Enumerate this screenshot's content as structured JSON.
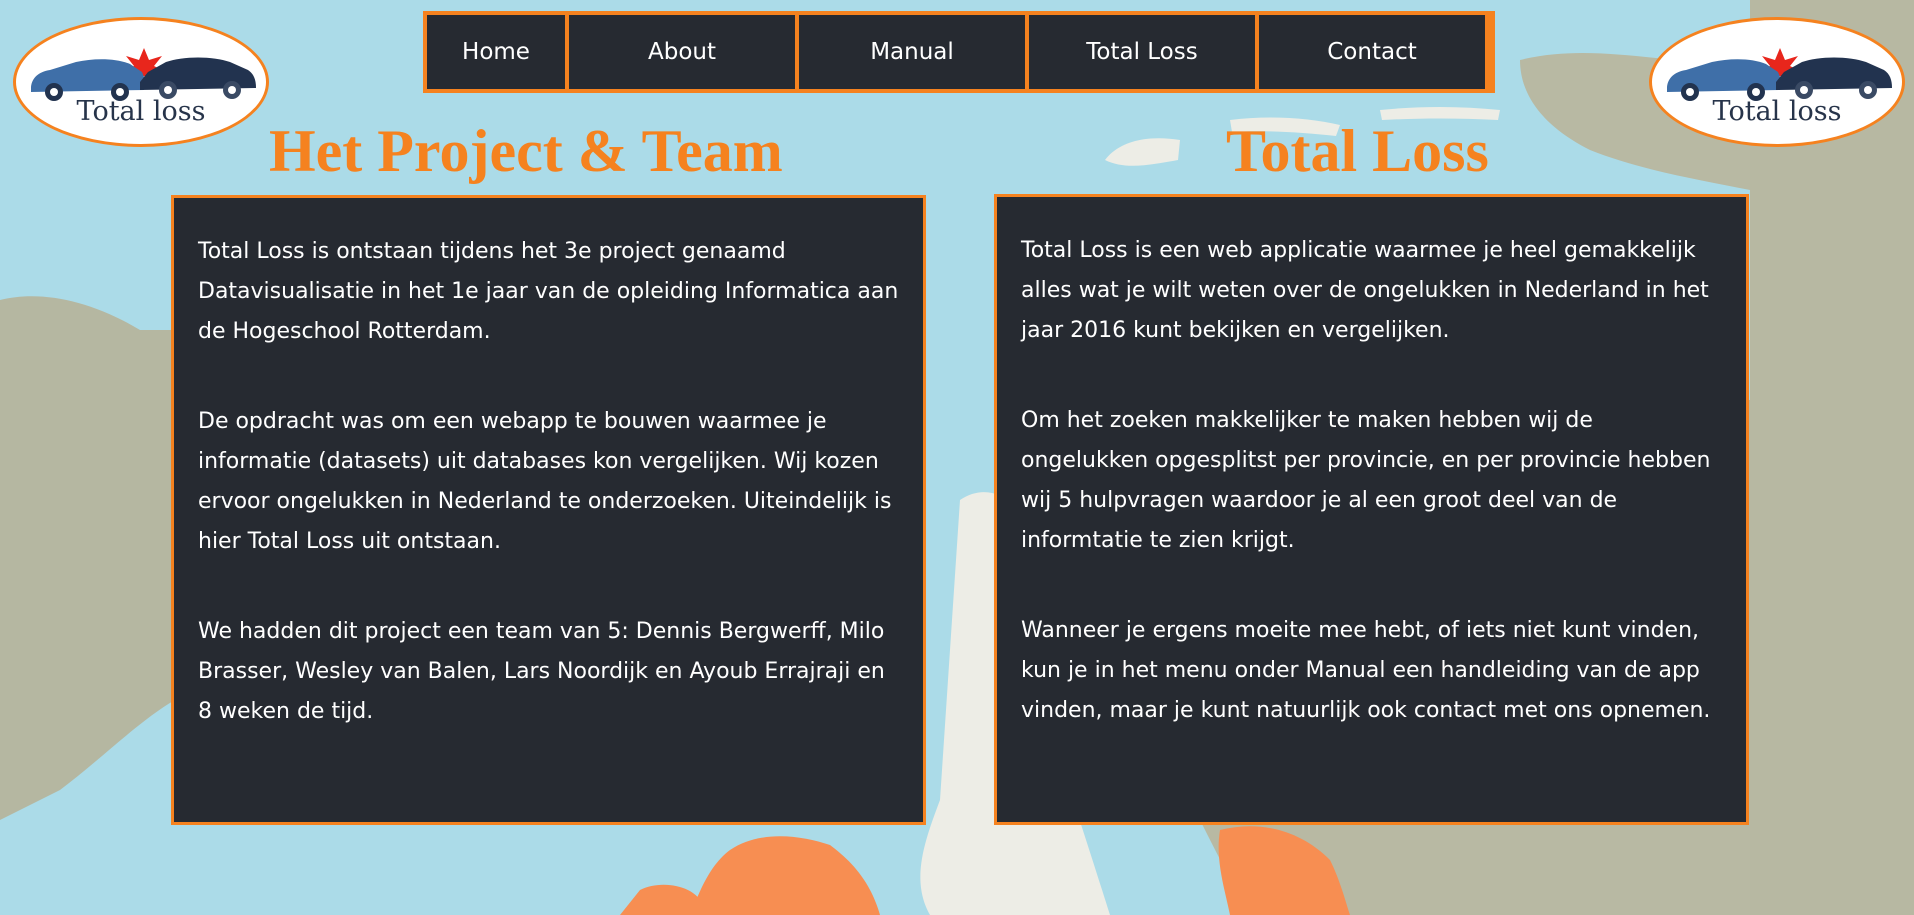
{
  "logo": {
    "text": "Total loss"
  },
  "nav": {
    "items": [
      {
        "label": "Home"
      },
      {
        "label": "About"
      },
      {
        "label": "Manual"
      },
      {
        "label": "Total Loss"
      },
      {
        "label": "Contact"
      }
    ]
  },
  "about": {
    "title": "Het Project & Team",
    "paragraphs": [
      "Total Loss is ontstaan tijdens het 3e project genaamd Datavisualisatie in het 1e jaar van de opleiding Informatica aan de Hogeschool Rotterdam.",
      "De opdracht was om een webapp te bouwen waarmee je informatie (datasets) uit databases kon vergelijken. Wij kozen ervoor ongelukken in Nederland te onderzoeken. Uiteindelijk is hier Total Loss uit ontstaan.",
      "We hadden dit project een team van 5: Dennis Bergwerff, Milo Brasser, Wesley van Balen, Lars Noordijk en Ayoub Errajraji en 8 weken de tijd."
    ]
  },
  "totalloss": {
    "title": "Total Loss",
    "paragraphs": [
      "Total Loss is een web applicatie waarmee je heel gemakkelijk alles wat je wilt weten over de ongelukken in Nederland in het jaar 2016 kunt bekijken en vergelijken.",
      "Om het zoeken makkelijker te maken hebben wij de ongelukken opgesplitst per provincie, en per provincie hebben wij 5 hulpvragen waardoor je al een groot deel van de informtatie te zien krijgt.",
      "Wanneer je ergens moeite mee hebt, of iets niet kunt vinden, kun je in het menu onder Manual een handleiding van de app vinden, maar je kunt natuurlijk ook contact met ons opnemen."
    ]
  },
  "colors": {
    "accent": "#f5821f",
    "panel": "#262a31",
    "water": "#abdbe8",
    "land": "#b8b9a3"
  }
}
